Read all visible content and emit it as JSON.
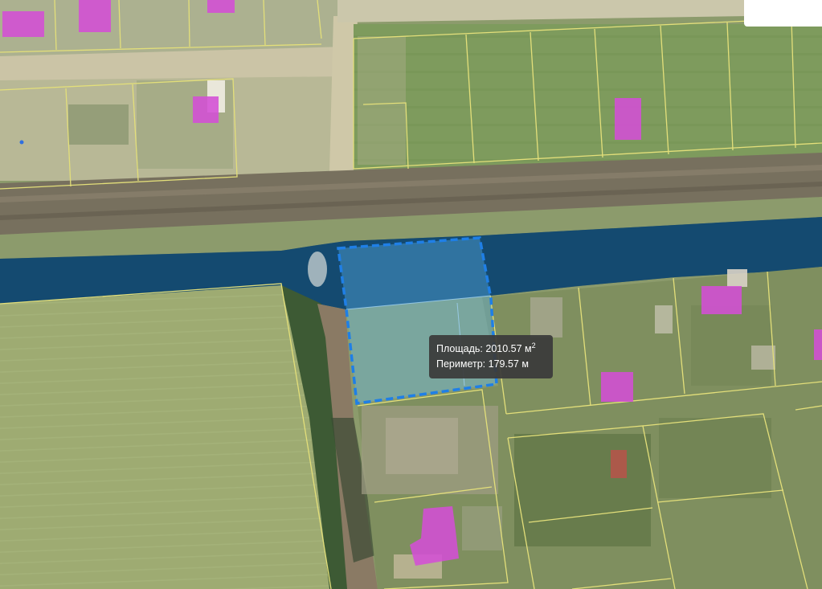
{
  "map": {
    "layer": "satellite-cadastral",
    "colors": {
      "parcel_border": "#e3df7a",
      "building_fill": "#d44fd6",
      "selection_stroke": "#1f7fe6",
      "selection_fill": "#5fb8f0",
      "zone_fill": "#0e4f88",
      "tooltip_bg": "#3a3a3a"
    }
  },
  "measurement": {
    "area_label": "Площадь:",
    "area_value": "2010.57 м",
    "area_unit_exp": "2",
    "perimeter_label": "Периметр:",
    "perimeter_value": "179.57 м"
  }
}
